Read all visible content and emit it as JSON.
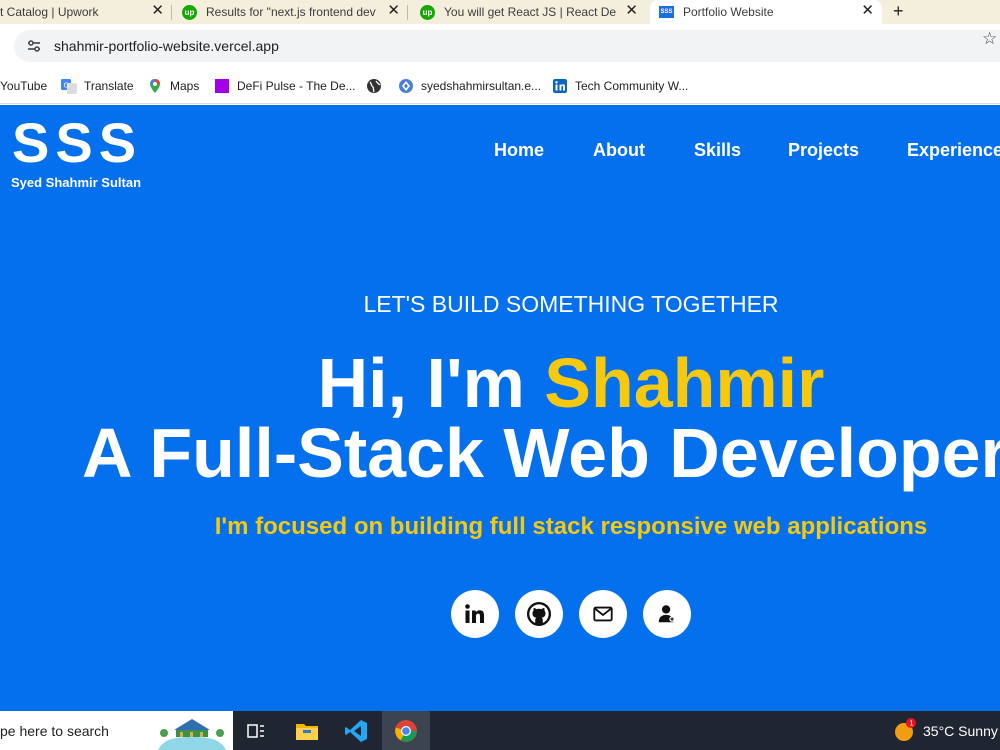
{
  "browser": {
    "tabs": [
      {
        "title": "t Catalog | Upwork",
        "icon": "none"
      },
      {
        "title": "Results for \"next.js frontend dev",
        "icon": "upwork-icon"
      },
      {
        "title": "You will get React JS | React Dev",
        "icon": "upwork-icon"
      },
      {
        "title": "Portfolio Website",
        "icon": "sss-favicon",
        "active": true
      }
    ],
    "new_tab": "+",
    "upwork_glyph": "up",
    "sss_glyph": "SSS",
    "url": "shahmir-portfolio-website.vercel.app",
    "bookmarks": [
      {
        "label": "YouTube",
        "icon": "none"
      },
      {
        "label": "Translate",
        "icon": "translate-icon"
      },
      {
        "label": "Maps",
        "icon": "maps-icon"
      },
      {
        "label": "DeFi Pulse - The De...",
        "icon": "defi-pulse-icon"
      },
      {
        "label": "",
        "icon": "globe-icon"
      },
      {
        "label": "syedshahmirsultan.e...",
        "icon": "web-icon"
      },
      {
        "label": "Tech Community W...",
        "icon": "linkedin-icon"
      }
    ]
  },
  "site": {
    "logo_mark": "SSS",
    "logo_name": "Syed Shahmir Sultan",
    "nav": [
      "Home",
      "About",
      "Skills",
      "Projects",
      "Experience"
    ],
    "hero": {
      "eyebrow": "LET'S BUILD SOMETHING TOGETHER",
      "greeting": "Hi, I'm ",
      "name": "Shahmir",
      "role": "A Full-Stack Web Developer",
      "tagline": "I'm focused on building full stack responsive web applications"
    },
    "social_links": [
      "linkedin-icon",
      "github-icon",
      "mail-icon",
      "contact-icon"
    ],
    "colors": {
      "background": "#0470ee",
      "highlight": "#f6c90e",
      "text": "#ffffff"
    }
  },
  "taskbar": {
    "search_placeholder": "pe here to search",
    "apps": [
      "task-view-icon",
      "file-explorer-icon",
      "vscode-icon",
      "chrome-icon"
    ],
    "notification_badge": "1",
    "weather_text": "35°C  Sunny"
  }
}
